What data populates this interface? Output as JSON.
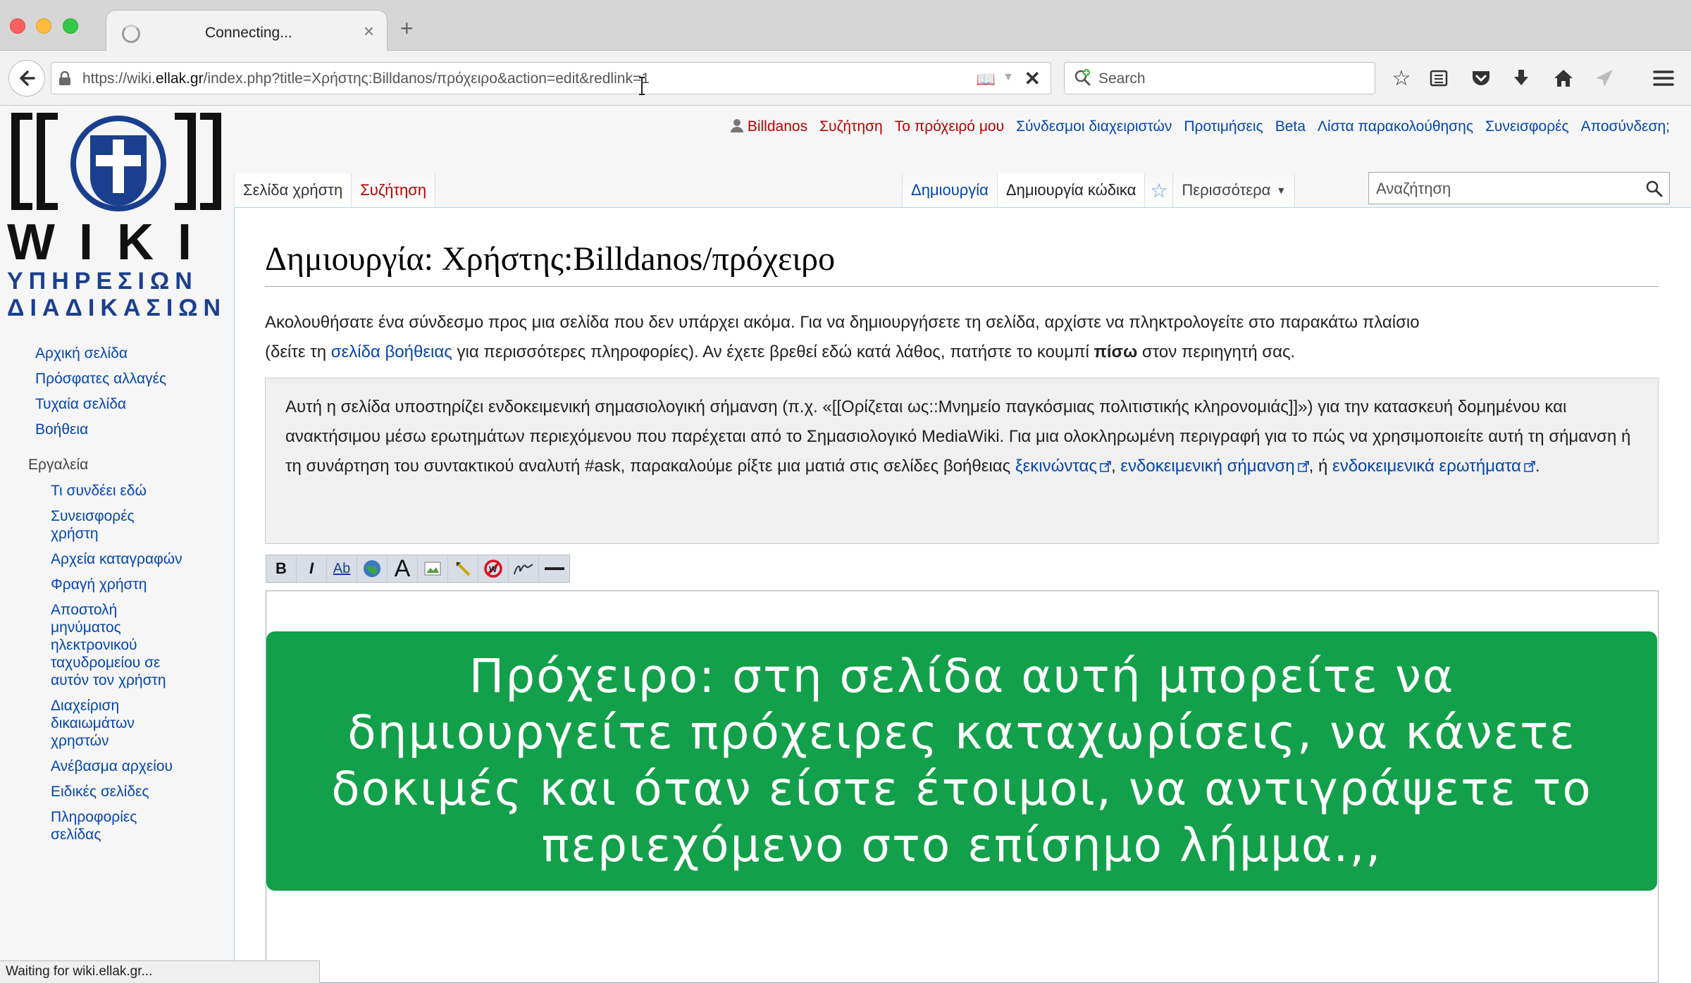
{
  "browser": {
    "tab_title": "Connecting...",
    "url_prefix": "https://wiki.",
    "url_domain": "ellak.gr",
    "url_rest": "/index.php?title=Χρήστης:Billdanos/πρόχειρο&action=edit&redlink=1",
    "search_placeholder": "Search",
    "status": "Waiting for wiki.ellak.gr..."
  },
  "logo": {
    "brackets": "[[  ]]",
    "wiki": "WIKI",
    "line1": "ΥΠΗΡΕΣΙΩΝ",
    "line2": "ΔΙΑΔΙΚΑΣΙΩΝ"
  },
  "personal": {
    "user": "Billdanos",
    "talk": "Συζήτηση",
    "sandbox": "Το πρόχειρό μου",
    "admin_links": "Σύνδεσμοι διαχειριστών",
    "preferences": "Προτιμήσεις",
    "beta": "Beta",
    "watchlist": "Λίστα παρακολούθησης",
    "contributions": "Συνεισφορές",
    "logout": "Αποσύνδεση;"
  },
  "tabs": {
    "user_page": "Σελίδα χρήστη",
    "discussion": "Συζήτηση",
    "create": "Δημιουργία",
    "create_source": "Δημιουργία κώδικα",
    "more": "Περισσότερα",
    "search_placeholder": "Αναζήτηση"
  },
  "sidebar": {
    "nav": [
      "Αρχική σελίδα",
      "Πρόσφατες αλλαγές",
      "Τυχαία σελίδα",
      "Βοήθεια"
    ],
    "tools_heading": "Εργαλεία",
    "tools": [
      "Τι συνδέει εδώ",
      "Συνεισφορές",
      "χρήστη",
      "Αρχεία καταγραφών",
      "Φραγή χρήστη",
      "Αποστολή",
      "μηνύματος",
      "ηλεκτρονικού",
      "ταχυδρομείου σε",
      "αυτόν τον χρήστη",
      "Διαχείριση",
      "δικαιωμάτων",
      "χρηστών",
      "Ανέβασμα αρχείου",
      "Ειδικές σελίδες",
      "Πληροφορίες",
      "σελίδας"
    ]
  },
  "main": {
    "title": "Δημιουργία: Χρήστης:Billdanos/πρόχειρο",
    "intro_1": "Ακολουθήσατε ένα σύνδεσμο προς μια σελίδα που δεν υπάρχει ακόμα. Για να δημιουργήσετε τη σελίδα, αρχίστε να πληκτρολογείτε στο παρακάτω πλαίσιο",
    "intro_2a": "(δείτε τη ",
    "intro_help_link": "σελίδα βοήθειας",
    "intro_2b": " για περισσότερες πληροφορίες). Αν έχετε βρεθεί εδώ κατά λάθος, πατήστε το κουμπί ",
    "intro_back": "πίσω",
    "intro_2c": " στον περιηγητή σας.",
    "smw_text": "Αυτή η σελίδα υποστηρίζει ενδοκειμενική σημασιολογική σήμανση (π.χ. «[[Ορίζεται ως::Μνημείο παγκόσμιας πολιτιστικής κληρονομιάς]]») για την κατασκευή δομημένου και ανακτήσιμου μέσω ερωτημάτων περιεχόμενου που παρέχεται από το Σημασιολογικό MediaWiki. Για μια ολοκληρωμένη περιγραφή για το πώς να χρησιμοποιείτε αυτή τη σήμανση ή τη συνάρτηση του συντακτικού αναλυτή #ask, παρακαλούμε ρίξτε μια ματιά στις σελίδες βοήθειας ",
    "smw_link1": "ξεκινώντας",
    "smw_sep1": ", ",
    "smw_link2": "ενδοκειμενική σήμανση",
    "smw_sep2": ", ή ",
    "smw_link3": "ενδοκειμενικά ερωτήματα",
    "smw_end": "."
  },
  "toolbar": {
    "bold": "B",
    "italic": "I",
    "link": "Ab",
    "big_a": "A"
  },
  "banner": {
    "text": "Πρόχειρο: στη σελίδα αυτή μπορείτε να δημιουργείτε πρόχειρες καταχωρίσεις, να κάνετε δοκιμές και όταν είστε έτοιμοι, να αντιγράψετε το περιεχόμενο στο επίσημο λήμμα.,,",
    "color": "#13a04a"
  },
  "colors": {
    "link": "#0645ad",
    "redlink": "#ba0000"
  }
}
